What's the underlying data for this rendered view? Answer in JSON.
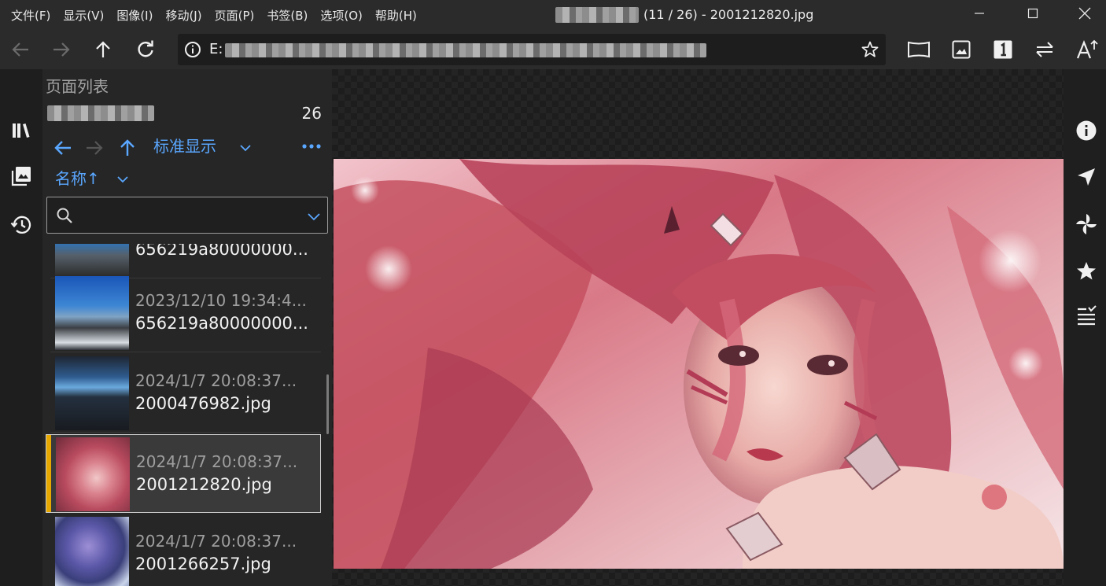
{
  "window": {
    "menu": [
      "文件(F)",
      "显示(V)",
      "图像(I)",
      "移动(J)",
      "页面(P)",
      "书签(B)",
      "选项(O)",
      "帮助(H)"
    ],
    "title": "(11 / 26) - 2001212820.jpg"
  },
  "toolbar": {
    "address_prefix": "E:"
  },
  "panel": {
    "title": "页面列表",
    "count": "26",
    "view_mode": "标准显示",
    "sort": "名称↑",
    "search_placeholder": ""
  },
  "list": {
    "items": [
      {
        "date": "",
        "name": "656219a80000000..."
      },
      {
        "date": "2023/12/10 19:34:4...",
        "name": "656219a80000000..."
      },
      {
        "date": "2024/1/7 20:08:37...",
        "name": "2000476982.jpg"
      },
      {
        "date": "2024/1/7 20:08:37...",
        "name": "2001212820.jpg"
      },
      {
        "date": "2024/1/7 20:08:37...",
        "name": "2001266257.jpg"
      }
    ],
    "selected_index": 3,
    "selected_accent": "#e6a800"
  },
  "colors": {
    "link": "#5aa7ff",
    "background": "#1b1b1b",
    "bar": "#2b2b2b"
  },
  "icons": {
    "left_rail": [
      "bookshelf-icon",
      "gallery-icon",
      "history-icon"
    ],
    "right_rail": [
      "info-icon",
      "navigator-icon",
      "pinwheel-icon",
      "star-icon",
      "list-icon"
    ],
    "toolbar": [
      "back-arrow-icon",
      "forward-arrow-icon",
      "up-arrow-icon",
      "refresh-icon",
      "info-icon",
      "star-outline-icon",
      "two-page-icon",
      "image-view-icon",
      "one-page-icon",
      "swap-direction-icon",
      "font-size-icon"
    ]
  }
}
